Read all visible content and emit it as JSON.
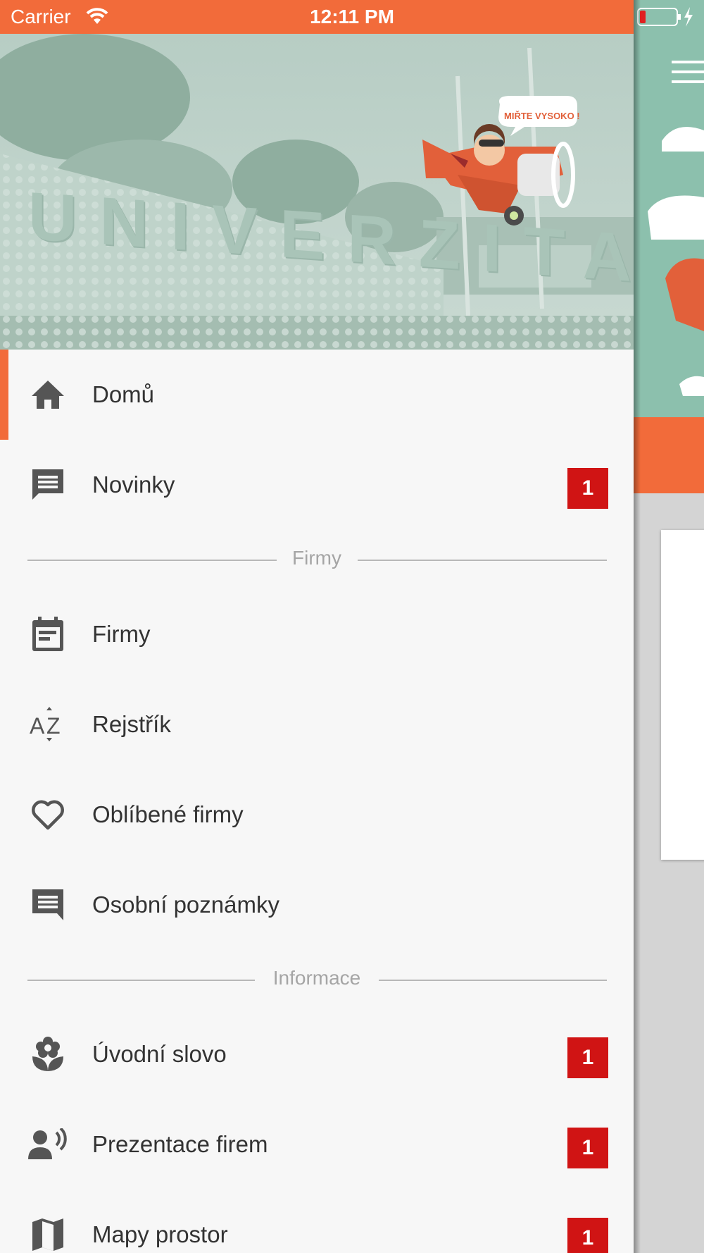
{
  "status_bar": {
    "carrier": "Carrier",
    "time": "12:11 PM"
  },
  "hero": {
    "sign_text": "UNIVERZITA",
    "banner_text": "MIŘTE VYSOKO !"
  },
  "menu": {
    "home": {
      "label": "Domů",
      "icon": "home-icon",
      "active": true
    },
    "news": {
      "label": "Novinky",
      "icon": "chat-icon",
      "badge": "1"
    },
    "section_companies": "Firmy",
    "companies": {
      "label": "Firmy",
      "icon": "calendar-icon"
    },
    "index": {
      "label": "Rejstřík",
      "icon": "sort-az-icon"
    },
    "favorites": {
      "label": "Oblíbené firmy",
      "icon": "heart-outline-icon"
    },
    "notes": {
      "label": "Osobní poznámky",
      "icon": "note-icon"
    },
    "section_info": "Informace",
    "intro": {
      "label": "Úvodní slovo",
      "icon": "flower-icon",
      "badge": "1"
    },
    "presentations": {
      "label": "Prezentace firem",
      "icon": "speaker-icon",
      "badge": "1"
    },
    "maps": {
      "label": "Mapy prostor",
      "icon": "map-icon",
      "badge": "1"
    }
  },
  "colors": {
    "accent": "#f26b3a",
    "badge": "#d01414",
    "background": "#f7f7f7"
  }
}
